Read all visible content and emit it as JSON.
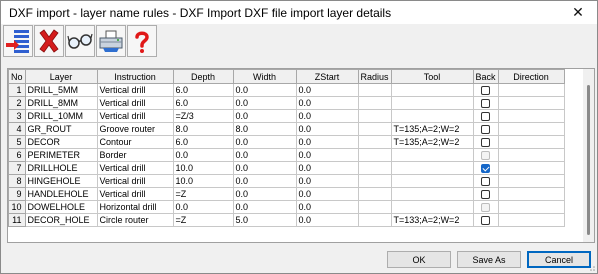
{
  "window": {
    "title": "DXF import - layer name rules - DXF Import DXF file import layer details",
    "close_glyph": "✕"
  },
  "toolbar": {
    "buttons": [
      {
        "name": "import-list-icon"
      },
      {
        "name": "delete-icon"
      },
      {
        "name": "glasses-icon"
      },
      {
        "name": "printer-icon"
      },
      {
        "name": "help-icon"
      }
    ]
  },
  "grid": {
    "columns": [
      "No",
      "Layer",
      "Instruction",
      "Depth",
      "Width",
      "ZStart",
      "Radius",
      "Tool",
      "Back",
      "Direction"
    ],
    "rows": [
      {
        "no": "1",
        "layer": "DRILL_5MM",
        "instruction": "Vertical drill",
        "depth": "6.0",
        "width": "0.0",
        "zstart": "0.0",
        "radius": "",
        "tool": "",
        "back": "unchecked",
        "direction": ""
      },
      {
        "no": "2",
        "layer": "DRILL_8MM",
        "instruction": "Vertical drill",
        "depth": "6.0",
        "width": "0.0",
        "zstart": "0.0",
        "radius": "",
        "tool": "",
        "back": "unchecked",
        "direction": ""
      },
      {
        "no": "3",
        "layer": "DRILL_10MM",
        "instruction": "Vertical drill",
        "depth": "=Z/3",
        "width": "0.0",
        "zstart": "0.0",
        "radius": "",
        "tool": "",
        "back": "unchecked",
        "direction": ""
      },
      {
        "no": "4",
        "layer": "GR_ROUT",
        "instruction": "Groove router",
        "depth": "8.0",
        "width": "8.0",
        "zstart": "0.0",
        "radius": "",
        "tool": "T=135;A=2;W=2",
        "back": "unchecked",
        "direction": ""
      },
      {
        "no": "5",
        "layer": "DECOR",
        "instruction": "Contour",
        "depth": "6.0",
        "width": "0.0",
        "zstart": "0.0",
        "radius": "",
        "tool": "T=135;A=2;W=2",
        "back": "unchecked",
        "direction": ""
      },
      {
        "no": "6",
        "layer": "PERIMETER",
        "instruction": "Border",
        "depth": "0.0",
        "width": "0.0",
        "zstart": "0.0",
        "radius": "",
        "tool": "",
        "back": "disabled",
        "direction": ""
      },
      {
        "no": "7",
        "layer": "DRILLHOLE",
        "instruction": "Vertical drill",
        "depth": "10.0",
        "width": "0.0",
        "zstart": "0.0",
        "radius": "",
        "tool": "",
        "back": "checked",
        "direction": ""
      },
      {
        "no": "8",
        "layer": "HINGEHOLE",
        "instruction": "Vertical drill",
        "depth": "10.0",
        "width": "0.0",
        "zstart": "0.0",
        "radius": "",
        "tool": "",
        "back": "unchecked",
        "direction": ""
      },
      {
        "no": "9",
        "layer": "HANDLEHOLE",
        "instruction": "Vertical drill",
        "depth": "=Z",
        "width": "0.0",
        "zstart": "0.0",
        "radius": "",
        "tool": "",
        "back": "unchecked",
        "direction": ""
      },
      {
        "no": "10",
        "layer": "DOWELHOLE",
        "instruction": "Horizontal drill",
        "depth": "0.0",
        "width": "0.0",
        "zstart": "0.0",
        "radius": "",
        "tool": "",
        "back": "disabled",
        "direction": ""
      },
      {
        "no": "11",
        "layer": "DECOR_HOLE",
        "instruction": "Circle router",
        "depth": "=Z",
        "width": "5.0",
        "zstart": "0.0",
        "radius": "",
        "tool": "T=133;A=2;W=2",
        "back": "unchecked",
        "direction": ""
      }
    ]
  },
  "buttons": {
    "ok": "OK",
    "save_as": "Save As",
    "cancel": "Cancel"
  },
  "colors": {
    "accent": "#0067c0",
    "checked": "#1667c8"
  }
}
